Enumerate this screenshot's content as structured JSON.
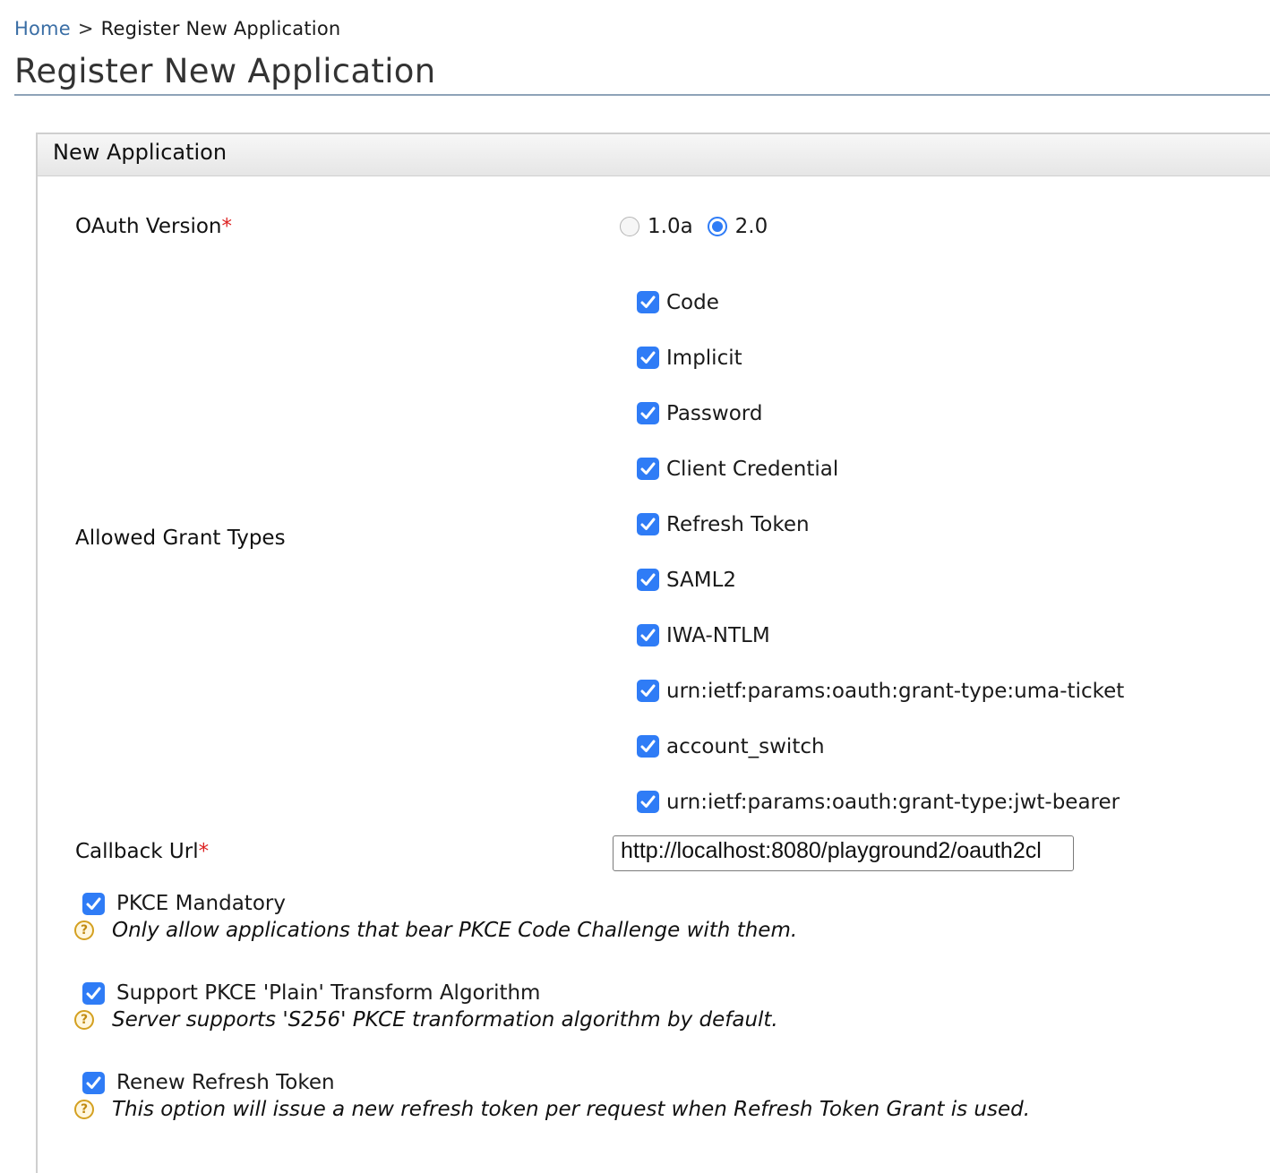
{
  "breadcrumb": {
    "home": "Home",
    "separator": ">",
    "current": "Register New Application"
  },
  "page_title": "Register New Application",
  "panel": {
    "title": "New Application"
  },
  "oauth_version": {
    "label": "OAuth Version",
    "required_mark": "*",
    "options": [
      {
        "label": "1.0a",
        "checked": false
      },
      {
        "label": "2.0",
        "checked": true
      }
    ]
  },
  "grant_types": {
    "label": "Allowed Grant Types",
    "items": [
      {
        "label": "Code",
        "checked": true
      },
      {
        "label": "Implicit",
        "checked": true
      },
      {
        "label": "Password",
        "checked": true
      },
      {
        "label": "Client Credential",
        "checked": true
      },
      {
        "label": "Refresh Token",
        "checked": true
      },
      {
        "label": "SAML2",
        "checked": true
      },
      {
        "label": "IWA-NTLM",
        "checked": true
      },
      {
        "label": "urn:ietf:params:oauth:grant-type:uma-ticket",
        "checked": true
      },
      {
        "label": "account_switch",
        "checked": true
      },
      {
        "label": "urn:ietf:params:oauth:grant-type:jwt-bearer",
        "checked": true
      }
    ]
  },
  "callback": {
    "label": "Callback Url",
    "required_mark": "*",
    "value": "http://localhost:8080/playground2/oauth2cl"
  },
  "options": {
    "pkce_mandatory": {
      "label": "PKCE Mandatory",
      "help": "Only allow applications that bear PKCE Code Challenge with them.",
      "checked": true
    },
    "pkce_plain": {
      "label": "Support PKCE 'Plain' Transform Algorithm",
      "help": "Server supports 'S256' PKCE tranformation algorithm by default.",
      "checked": true
    },
    "renew_refresh": {
      "label": "Renew Refresh Token",
      "help": "This option will issue a new refresh token per request when Refresh Token Grant is used.",
      "checked": true
    }
  },
  "colors": {
    "accent": "#2f7cf6",
    "link": "#3a6ea5",
    "required": "#dd2222",
    "help_icon": "#d4a020"
  },
  "icons": {
    "checkbox": "checkmark-icon",
    "help": "question-circle-icon"
  }
}
